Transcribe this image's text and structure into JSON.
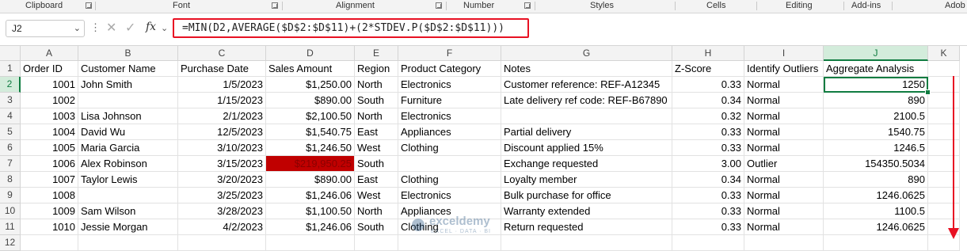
{
  "ribbon": {
    "groups": [
      "Clipboard",
      "Font",
      "Alignment",
      "Number",
      "Styles",
      "Cells",
      "Editing",
      "Add-ins",
      "Adob"
    ]
  },
  "formula_bar": {
    "name_box": "J2",
    "fx_label": "fx",
    "formula": "=MIN(D2,AVERAGE($D$2:$D$11)+(2*STDEV.P($D$2:$D$11)))"
  },
  "columns": [
    "A",
    "B",
    "C",
    "D",
    "E",
    "F",
    "G",
    "H",
    "I",
    "J",
    "K"
  ],
  "rows": [
    "1",
    "2",
    "3",
    "4",
    "5",
    "6",
    "7",
    "8",
    "9",
    "10",
    "11",
    "12"
  ],
  "table": {
    "headers": [
      "Order ID",
      "Customer Name",
      "Purchase Date",
      "Sales Amount",
      "Region",
      "Product Category",
      "Notes",
      "Z-Score",
      "Identify Outliers",
      "Aggregate Analysis"
    ],
    "data": [
      [
        "1001",
        "John Smith",
        "1/5/2023",
        "$1,250.00",
        "North",
        "Electronics",
        "Customer reference: REF-A12345",
        "0.33",
        "Normal",
        "1250"
      ],
      [
        "1002",
        "",
        "1/15/2023",
        "$890.00",
        "South",
        "Furniture",
        "Late delivery ref code: REF-B67890",
        "0.34",
        "Normal",
        "890"
      ],
      [
        "1003",
        "Lisa Johnson",
        "2/1/2023",
        "$2,100.50",
        "North",
        "Electronics",
        "",
        "0.32",
        "Normal",
        "2100.5"
      ],
      [
        "1004",
        "David Wu",
        "12/5/2023",
        "$1,540.75",
        "East",
        "Appliances",
        "Partial delivery",
        "0.33",
        "Normal",
        "1540.75"
      ],
      [
        "1005",
        "Maria Garcia",
        "3/10/2023",
        "$1,246.50",
        "West",
        "Clothing",
        "Discount applied 15%",
        "0.33",
        "Normal",
        "1246.5"
      ],
      [
        "1006",
        "Alex Robinson",
        "3/15/2023",
        "$219,950.25",
        "South",
        "",
        "Exchange requested",
        "3.00",
        "Outlier",
        "154350.5034"
      ],
      [
        "1007",
        "Taylor Lewis",
        "3/20/2023",
        "$890.00",
        "East",
        "Clothing",
        "Loyalty member",
        "0.34",
        "Normal",
        "890"
      ],
      [
        "1008",
        "",
        "3/25/2023",
        "$1,246.06",
        "West",
        "Electronics",
        "Bulk purchase for office",
        "0.33",
        "Normal",
        "1246.0625"
      ],
      [
        "1009",
        "Sam Wilson",
        "3/28/2023",
        "$1,100.50",
        "North",
        "Appliances",
        "Warranty extended",
        "0.33",
        "Normal",
        "1100.5"
      ],
      [
        "1010",
        "Jessie Morgan",
        "4/2/2023",
        "$1,246.06",
        "South",
        "Clothing",
        "Return requested",
        "0.33",
        "Normal",
        "1246.0625"
      ]
    ]
  },
  "watermark": {
    "title": "exceldemy",
    "subtitle": "EXCEL · DATA · BI"
  },
  "colors": {
    "accent": "#107c41",
    "highlight": "#c00000",
    "annotation": "#e81123"
  }
}
